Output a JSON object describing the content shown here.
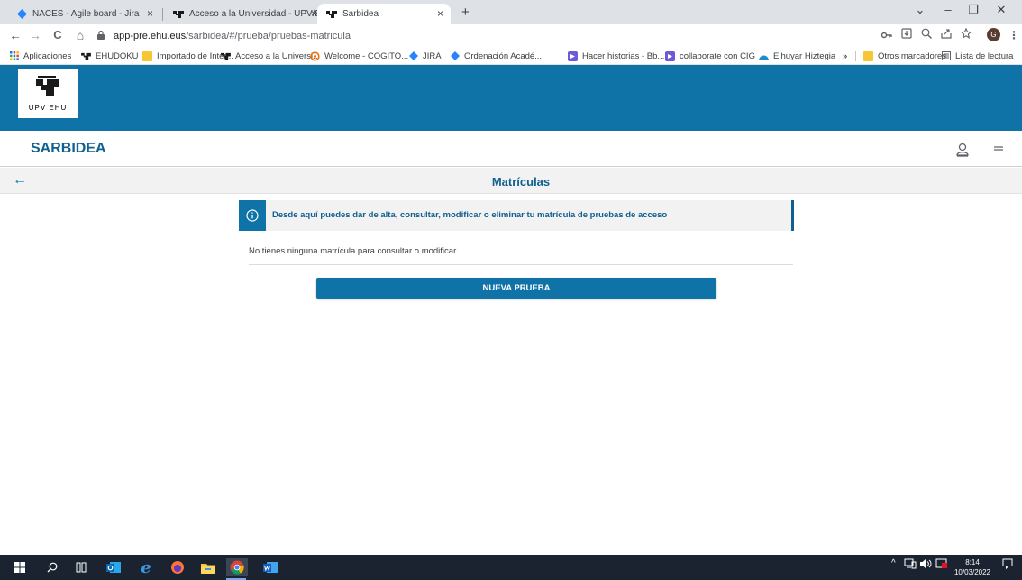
{
  "browser": {
    "tabs": [
      {
        "title": "NACES - Agile board - Jira",
        "icon": "jira-icon",
        "close": "×"
      },
      {
        "title": "Acceso a la Universidad - UPV/EH",
        "icon": "upv-ehu-icon",
        "close": "×"
      },
      {
        "title": "Sarbidea",
        "icon": "upv-ehu-icon",
        "close": "×"
      }
    ],
    "new_tab": "+",
    "window_controls": {
      "dropdown": "⌄",
      "minimize": "–",
      "restore": "❐",
      "close": "✕"
    },
    "toolbar": {
      "back": "←",
      "forward": "→",
      "reload": "C",
      "home": "⌂"
    },
    "url": {
      "host": "app-pre.ehu.eus",
      "path": "/sarbidea/#/prueba/pruebas-matricula"
    },
    "toolbar_icons": [
      "key-icon",
      "install-icon",
      "zoom-icon",
      "share-icon",
      "star-icon"
    ],
    "profile_initial": "G",
    "menu": "⋮",
    "bookmarks": [
      {
        "label": "Aplicaciones",
        "icon": "apps-grid-icon"
      },
      {
        "label": "EHUDOKU",
        "icon": "upv-ehu-icon"
      },
      {
        "label": "Importado de Inter...",
        "icon": "folder-icon"
      },
      {
        "label": "Acceso a la Universi...",
        "icon": "upv-ehu-icon"
      },
      {
        "label": "Welcome - COGITO...",
        "icon": "cogito-icon"
      },
      {
        "label": "JIRA",
        "icon": "jira-icon"
      },
      {
        "label": "Ordenación Acadé...",
        "icon": "jira-icon"
      },
      {
        "label": "Hacer historias - Bb...",
        "icon": "blackboard-icon"
      },
      {
        "label": "collaborate con CIG",
        "icon": "blackboard-icon"
      },
      {
        "label": "Elhuyar Hiztegia",
        "icon": "elhuyar-icon"
      }
    ],
    "bookmarks_overflow": "»",
    "other_bookmarks": "Otros marcadores",
    "reading_list": "Lista de lectura"
  },
  "page": {
    "logo_text": "UPV  EHU",
    "app_title": "SARBIDEA",
    "back": "←",
    "title": "Matrículas",
    "info_message": "Desde aquí puedes dar de alta, consultar, modificar o eliminar tu matrícula de pruebas de acceso",
    "empty_message": "No tienes ninguna matrícula para consultar o modificar.",
    "new_button": "NUEVA PRUEBA"
  },
  "taskbar": {
    "time": "8:14",
    "date": "10/03/2022",
    "apps": [
      "windows-start-icon",
      "search-icon",
      "task-view-icon",
      "outlook-icon",
      "edge-icon",
      "firefox-icon",
      "file-explorer-icon",
      "chrome-icon",
      "word-icon"
    ]
  },
  "colors": {
    "brand_blue": "#0f73a8",
    "title_blue": "#0f5f8f",
    "taskbar": "#1b2330"
  }
}
